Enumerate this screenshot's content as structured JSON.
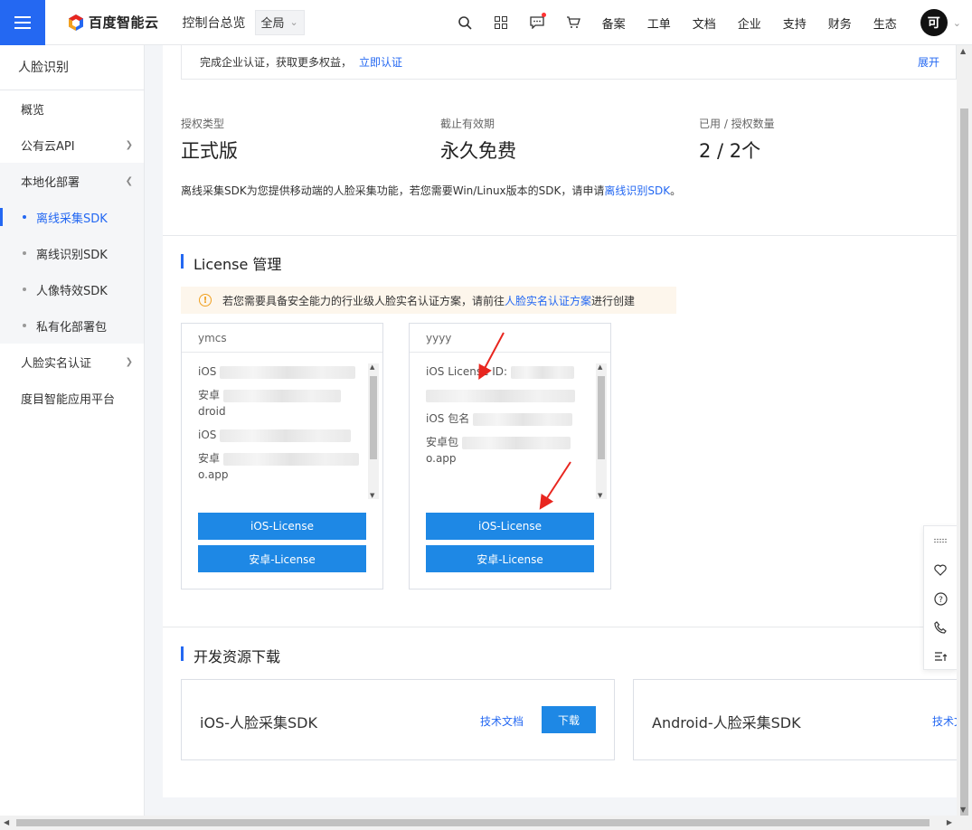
{
  "topbar": {
    "brand": "百度智能云",
    "console": "控制台总览",
    "region": "全局",
    "nav": [
      "备案",
      "工单",
      "文档",
      "企业",
      "支持",
      "财务",
      "生态"
    ],
    "avatar": "可",
    "icons": [
      "search-icon",
      "apps-icon",
      "message-icon",
      "cart-icon"
    ]
  },
  "sidebar": {
    "title": "人脸识别",
    "items": [
      {
        "label": "概览"
      },
      {
        "label": "公有云API"
      },
      {
        "label": "本地化部署"
      },
      {
        "label": "人脸实名认证"
      },
      {
        "label": "度目智能应用平台"
      }
    ],
    "subitems": [
      "离线采集SDK",
      "离线识别SDK",
      "人像特效SDK",
      "私有化部署包"
    ],
    "active": "离线采集SDK"
  },
  "notice": {
    "text": "完成企业认证，获取更多权益，",
    "link": "立即认证",
    "expand": "展开"
  },
  "stats": [
    {
      "label": "授权类型",
      "value": "正式版"
    },
    {
      "label": "截止有效期",
      "value": "永久免费"
    },
    {
      "label": "已用 / 授权数量",
      "value": "2 / 2个"
    }
  ],
  "description": {
    "text": "离线采集SDK为您提供移动端的人脸采集功能，若您需要Win/Linux版本的SDK，请申请",
    "link": "离线识别SDK",
    "end": "。"
  },
  "license": {
    "title": "License 管理",
    "warning": {
      "icon": "warning-icon",
      "text": "若您需要具备安全能力的行业级人脸实名认证方案，请前往",
      "link": "人脸实名认证方案",
      "end": "进行创建"
    },
    "cards": [
      {
        "name": "ymcs",
        "fields": [
          "iOS",
          "安卓",
          "droid",
          "iOS",
          "安卓",
          "o.app"
        ],
        "ios_button": "iOS-License",
        "android_button": "安卓-License"
      },
      {
        "name": "yyyy",
        "fields": [
          "iOS License ID:",
          "",
          "iOS 包名",
          "安卓包",
          "o.app"
        ],
        "ios_button": "iOS-License",
        "android_button": "安卓-License"
      }
    ]
  },
  "downloads": {
    "title": "开发资源下载",
    "items": [
      {
        "name": "iOS-人脸采集SDK",
        "doc": "技术文档",
        "button": "下载"
      },
      {
        "name": "Android-人脸采集SDK",
        "doc": "技术文"
      }
    ]
  },
  "colors": {
    "accent": "#2468f2",
    "button": "#1e88e5",
    "annotation": "#e8261f"
  }
}
